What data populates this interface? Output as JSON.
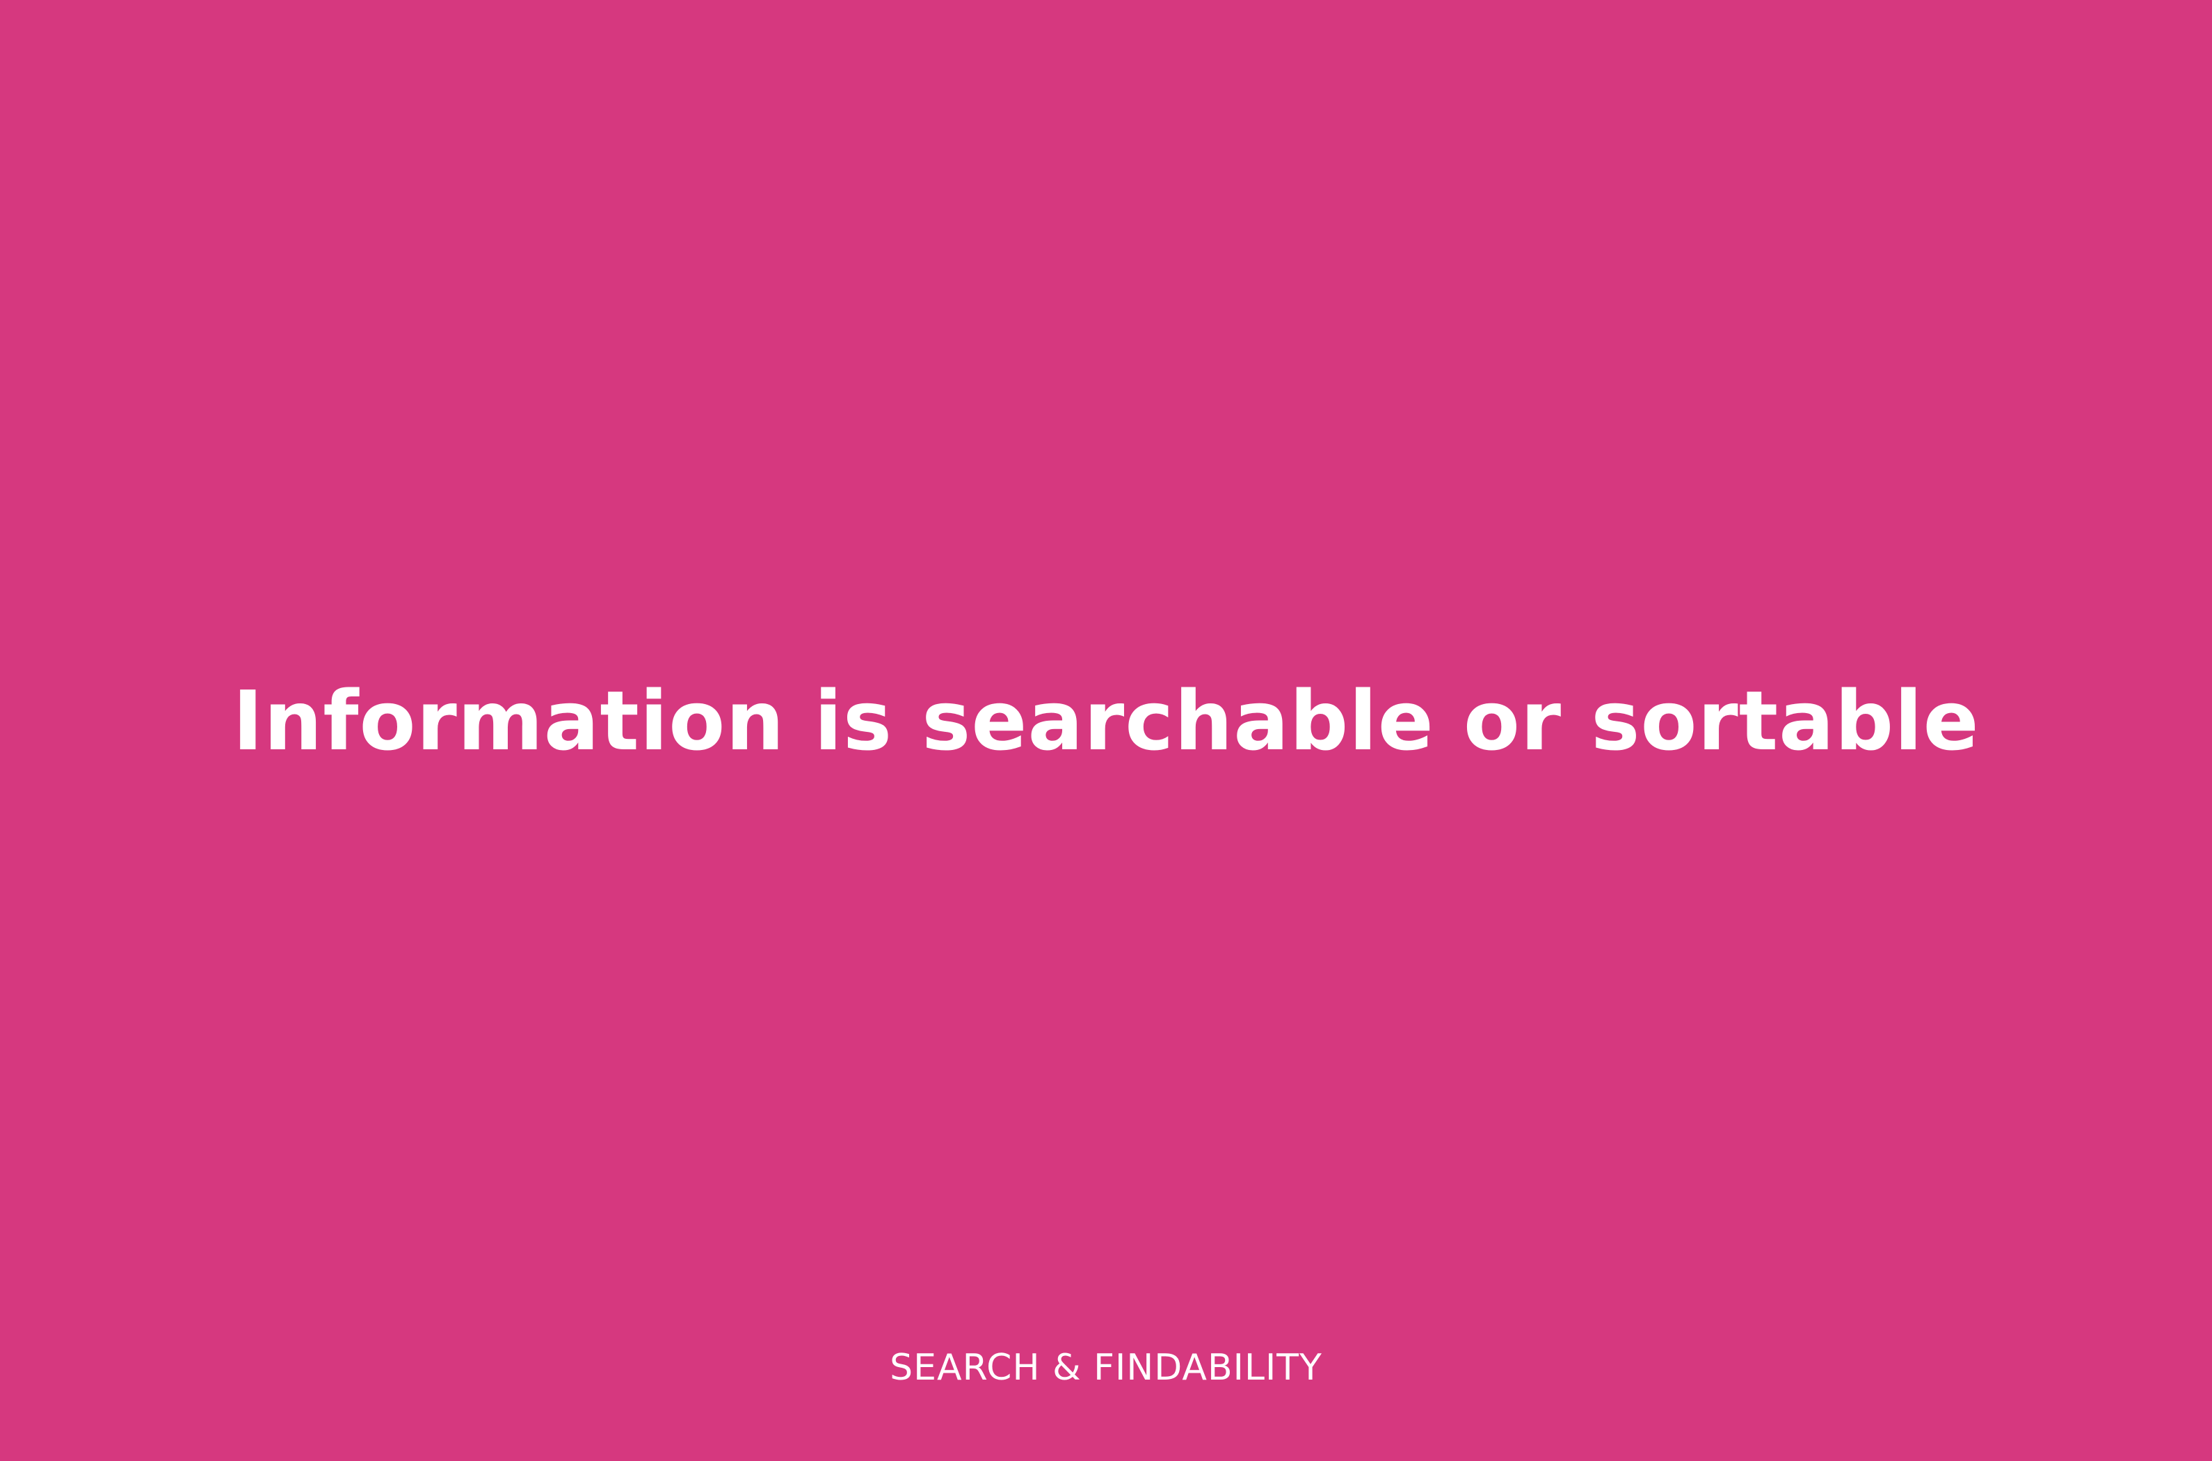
{
  "slide": {
    "background_color": "#D6387F",
    "text_color": "#FFFFFF",
    "headline": "Information is searchable or sortable",
    "category": "SEARCH & FINDABILITY"
  }
}
